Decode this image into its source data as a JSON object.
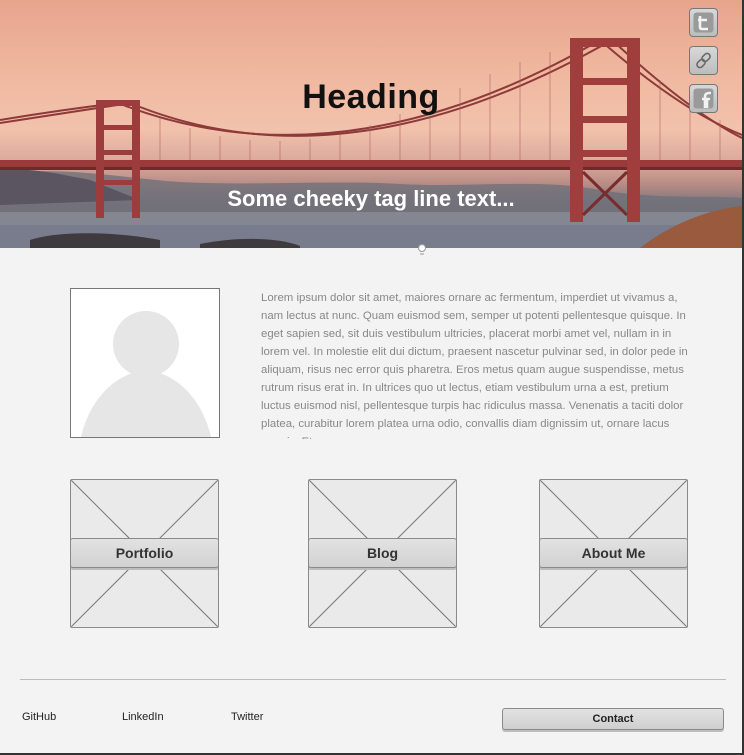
{
  "hero": {
    "heading": "Heading",
    "tagline": "Some cheeky tag line text..."
  },
  "social": [
    {
      "icon": "twitter-icon"
    },
    {
      "icon": "link-icon"
    },
    {
      "icon": "facebook-icon"
    }
  ],
  "profile": {
    "bio": "Lorem ipsum dolor sit amet, maiores ornare ac fermentum, imperdiet ut vivamus a, nam lectus at nunc. Quam euismod sem, semper ut potenti pellentesque quisque. In eget sapien sed, sit duis vestibulum ultricies, placerat morbi amet vel, nullam in in lorem vel. In molestie elit dui dictum, praesent nascetur pulvinar sed, in dolor pede in aliquam, risus nec error quis pharetra. Eros metus quam augue suspendisse, metus rutrum risus erat in.  In ultrices quo ut lectus, etiam vestibulum urna a est, pretium luctus euismod nisl, pellentesque turpis hac ridiculus massa. Venenatis a taciti dolor platea, curabitur lorem platea urna odio, convallis diam dignissim ut, ornare lacus mauris. Et"
  },
  "tiles": [
    {
      "label": "Portfolio"
    },
    {
      "label": "Blog"
    },
    {
      "label": "About Me"
    }
  ],
  "footer": {
    "links": [
      "GitHub",
      "LinkedIn",
      "Twitter"
    ],
    "contact_label": "Contact"
  }
}
